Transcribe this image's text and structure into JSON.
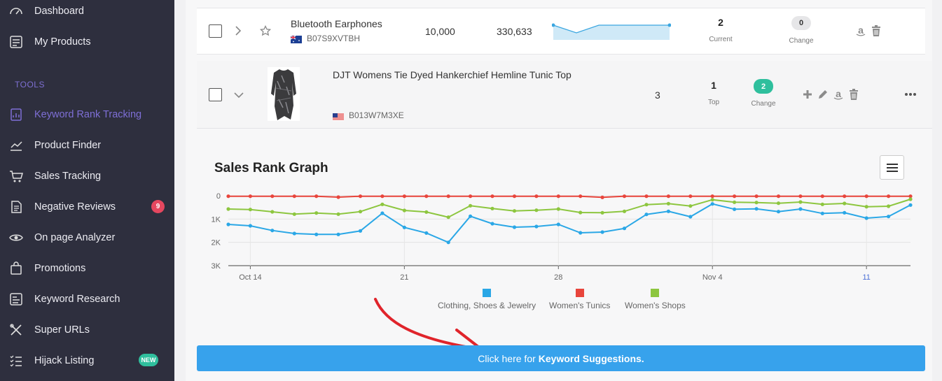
{
  "sidebar": {
    "items_top": [
      {
        "label": "Dashboard",
        "icon": "dashboard-icon"
      },
      {
        "label": "My Products",
        "icon": "products-icon"
      }
    ],
    "section_label": "TOOLS",
    "tools": [
      {
        "label": "Keyword Rank Tracking",
        "icon": "rank-tracking-icon",
        "active": true
      },
      {
        "label": "Product Finder",
        "icon": "chart-icon"
      },
      {
        "label": "Sales Tracking",
        "icon": "cart-icon"
      },
      {
        "label": "Negative Reviews",
        "icon": "document-icon",
        "badge": "9"
      },
      {
        "label": "On page Analyzer",
        "icon": "eye-icon"
      },
      {
        "label": "Promotions",
        "icon": "bag-icon"
      },
      {
        "label": "Keyword Research",
        "icon": "keyword-icon"
      },
      {
        "label": "Super URLs",
        "icon": "tools-icon"
      },
      {
        "label": "Hijack Listing",
        "icon": "list-icon",
        "badge": "NEW"
      }
    ],
    "accent": "#7e6fd6"
  },
  "row1": {
    "name": "Bluetooth Earphones",
    "asin": "B07S9XVTBH",
    "flag": "australia-flag",
    "col1": "10,000",
    "col2": "330,633",
    "rank": "2",
    "rank_label": "Current",
    "change": "0",
    "change_label": "Change"
  },
  "row2": {
    "name": "DJT Womens Tie Dyed Hankerchief Hemline Tunic Top",
    "asin": "B013W7M3XE",
    "flag": "us-flag",
    "col1": "3",
    "rank": "1",
    "rank_label": "Top",
    "change": "2",
    "change_label": "Change"
  },
  "chart_data": {
    "type": "line",
    "title": "Sales Rank Graph",
    "ylim": [
      0,
      3000
    ],
    "y_ticks": [
      "0",
      "1K",
      "2K",
      "3K"
    ],
    "x_ticks": [
      "Oct 14",
      "21",
      "28",
      "Nov 4",
      "11"
    ],
    "x": [
      "Oct 13",
      "Oct 14",
      "Oct 15",
      "Oct 16",
      "Oct 17",
      "Oct 18",
      "Oct 19",
      "Oct 20",
      "Oct 21",
      "Oct 22",
      "Oct 23",
      "Oct 24",
      "Oct 25",
      "Oct 26",
      "Oct 27",
      "Oct 28",
      "Oct 29",
      "Oct 30",
      "Oct 31",
      "Nov 1",
      "Nov 2",
      "Nov 3",
      "Nov 4",
      "Nov 5",
      "Nov 6",
      "Nov 7",
      "Nov 8",
      "Nov 9",
      "Nov 10",
      "Nov 11",
      "Nov 12",
      "Nov 13"
    ],
    "series": [
      {
        "name": "Clothing, Shoes & Jewelry",
        "color": "#2aa7e6",
        "values": [
          1230,
          1290,
          1490,
          1620,
          1660,
          1660,
          1510,
          750,
          1360,
          1600,
          2000,
          880,
          1200,
          1350,
          1320,
          1230,
          1590,
          1560,
          1400,
          800,
          670,
          900,
          350,
          580,
          560,
          680,
          570,
          760,
          730,
          960,
          890,
          400
        ]
      },
      {
        "name": "Women's Tunics",
        "color": "#e8453c",
        "values": [
          20,
          20,
          20,
          20,
          20,
          60,
          20,
          20,
          20,
          20,
          20,
          20,
          20,
          20,
          20,
          20,
          20,
          70,
          20,
          20,
          20,
          20,
          20,
          20,
          20,
          20,
          20,
          20,
          20,
          20,
          20,
          20
        ]
      },
      {
        "name": "Women's Shops",
        "color": "#8dc63f",
        "values": [
          570,
          590,
          690,
          790,
          740,
          790,
          680,
          370,
          630,
          700,
          920,
          430,
          550,
          650,
          620,
          570,
          720,
          730,
          670,
          380,
          340,
          440,
          170,
          280,
          290,
          320,
          270,
          370,
          330,
          470,
          450,
          150
        ]
      }
    ],
    "grid": "horizontal",
    "legend": "bottom-center"
  },
  "cta": {
    "prefix": "Click here for",
    "strong": "Keyword Suggestions."
  }
}
